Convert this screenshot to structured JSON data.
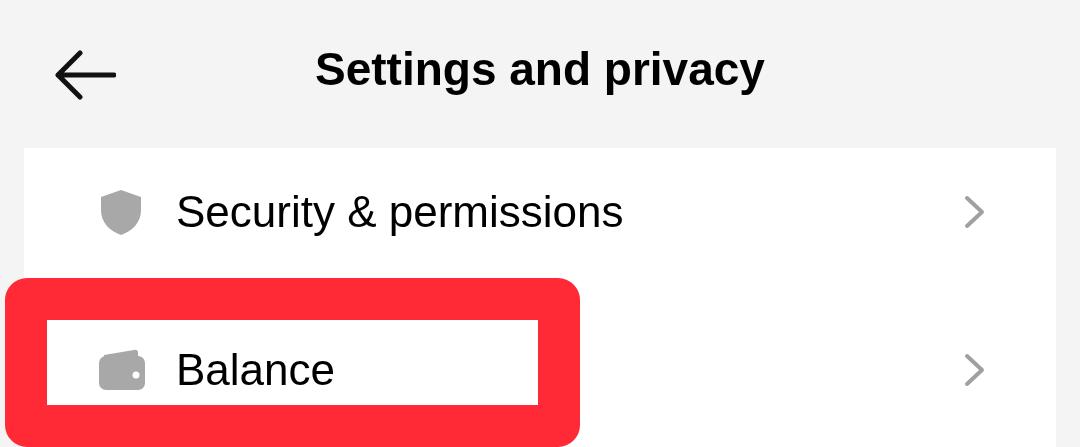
{
  "header": {
    "title": "Settings and privacy"
  },
  "items": [
    {
      "kind": "security",
      "label": "Security & permissions",
      "highlighted": false
    },
    {
      "kind": "wallet",
      "label": "Balance",
      "highlighted": true
    }
  ]
}
